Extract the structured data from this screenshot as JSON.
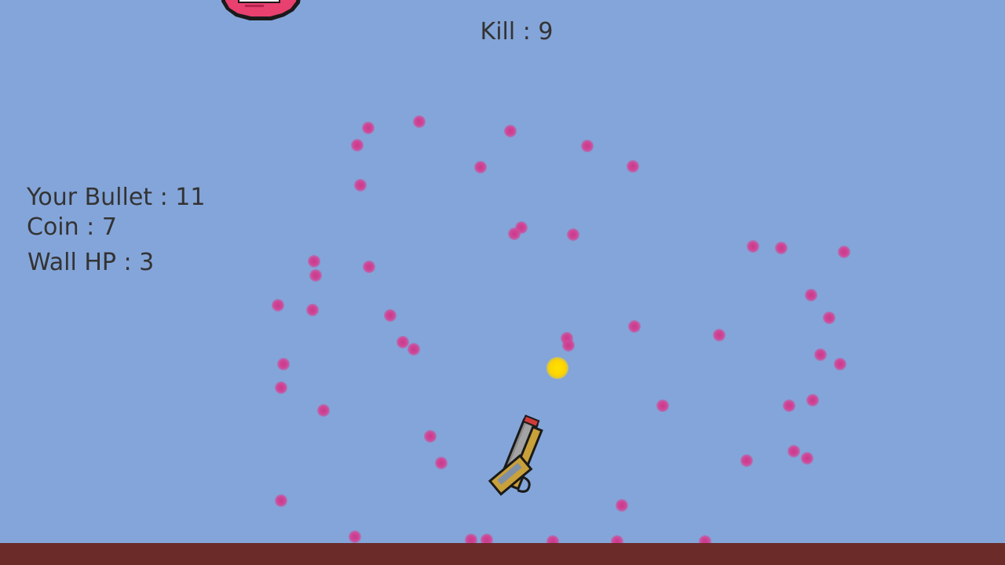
{
  "hud": {
    "kill_label": "Kill : 9",
    "bullet_label": "Your Bullet : 11",
    "coin_label": "Coin : 7",
    "wall_hp_label": "Wall HP : 3"
  },
  "stats": {
    "kills": 9,
    "bullets": 11,
    "coins": 7,
    "wall_hp": 3
  },
  "colors": {
    "sky": "#84a5d9",
    "ground": "#6b2b28",
    "particle": "#d14696",
    "coin": "#ffd400",
    "enemy": "#e8406f",
    "text": "#333333"
  },
  "sprites": {
    "enemy": "pink-blob-enemy",
    "gun": "golden-pistol",
    "coin": "gold-coin"
  }
}
